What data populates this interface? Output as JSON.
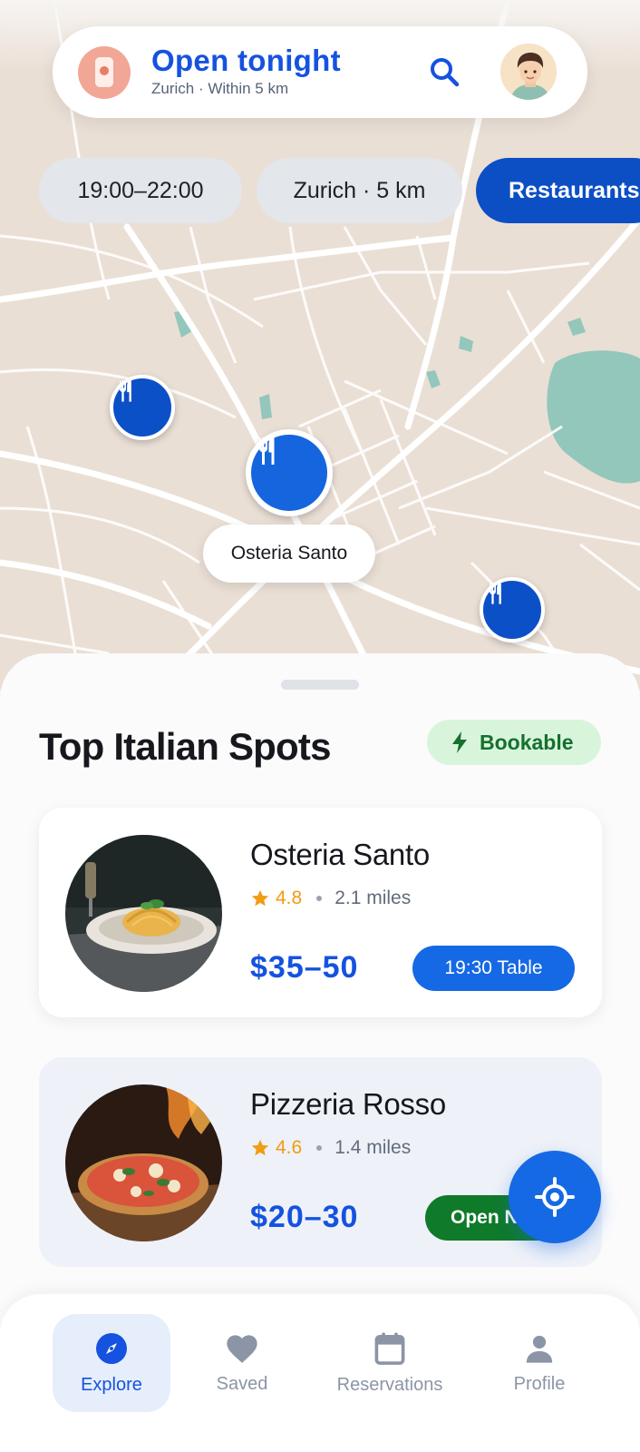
{
  "header": {
    "title": "Open tonight",
    "subtitle": "Zurich · Within 5 km"
  },
  "filters": {
    "time": "19:00–22:00",
    "location": "Zurich · 5 km",
    "category": "Restaurants"
  },
  "map": {
    "selected_label": "Osteria Santo",
    "pin_icon": "fork-knife-icon"
  },
  "section": {
    "title": "Top Italian Spots",
    "badge": "Bookable"
  },
  "restaurants": [
    {
      "name": "Osteria Santo",
      "rating": "4.8",
      "distance": "2.1 miles",
      "price": "$35–50",
      "action": "19:30 Table",
      "image": "spaghetti-dish"
    },
    {
      "name": "Pizzeria Rosso",
      "rating": "4.6",
      "distance": "1.4 miles",
      "price": "$20–30",
      "action": "Open Now",
      "image": "pizza-dish"
    }
  ],
  "nav": {
    "explore": "Explore",
    "saved": "Saved",
    "reservations": "Reservations",
    "profile": "Profile"
  },
  "colors": {
    "primary": "#1552e0",
    "accent": "#1669e4",
    "green": "#0f7a2a",
    "rating": "#f29c11",
    "map": "#eadfd5"
  }
}
